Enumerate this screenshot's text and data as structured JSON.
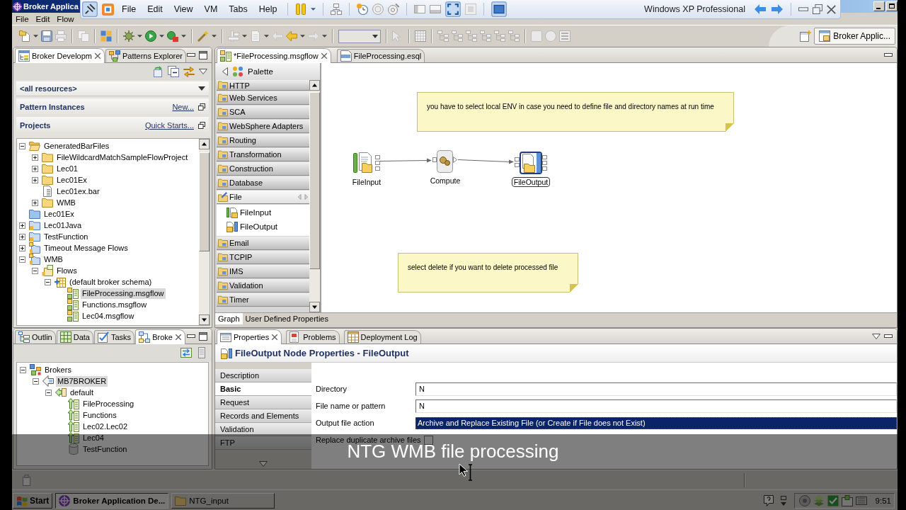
{
  "window": {
    "title": "Broker Applica",
    "menu": [
      "File",
      "Edit",
      "Flow"
    ]
  },
  "vm_toolbar": {
    "menu": [
      "File",
      "Edit",
      "View",
      "VM",
      "Tabs",
      "Help"
    ],
    "guest_name": "Windows XP Professional"
  },
  "perspective": {
    "label": "Broker Applic..."
  },
  "navigator": {
    "tabs": [
      {
        "label": "Broker Developm",
        "selected": true
      },
      {
        "label": "Patterns Explorer",
        "selected": false
      }
    ],
    "filter": "<all resources>",
    "sections": [
      {
        "title": "Pattern Instances",
        "link": "New..."
      },
      {
        "title": "Projects",
        "link": "Quick Starts..."
      }
    ],
    "tree": [
      {
        "label": "GeneratedBarFiles",
        "kind": "folder",
        "expanded": true,
        "selected": false,
        "children": [
          {
            "label": "FileWildcardMatchSampleFlowProject",
            "kind": "folder",
            "expanded": false,
            "selected": false
          },
          {
            "label": "Lec01",
            "kind": "folder",
            "expanded": false,
            "selected": false
          },
          {
            "label": "Lec01Ex",
            "kind": "folder",
            "expanded": false,
            "selected": false
          },
          {
            "label": "Lec01ex.bar",
            "kind": "bar",
            "selected": false
          },
          {
            "label": "WMB",
            "kind": "folder",
            "expanded": false,
            "selected": false
          }
        ]
      },
      {
        "label": "Lec01Ex",
        "kind": "closed-project",
        "selected": false
      },
      {
        "label": "Lec01Java",
        "kind": "project",
        "expanded": false,
        "selected": false
      },
      {
        "label": "TestFunction",
        "kind": "project",
        "expanded": false,
        "selected": false
      },
      {
        "label": "Timeout Message Flows",
        "kind": "flow-project",
        "expanded": false,
        "selected": false
      },
      {
        "label": "WMB",
        "kind": "flow-project",
        "expanded": true,
        "selected": false,
        "children": [
          {
            "label": "Flows",
            "kind": "flows",
            "expanded": true,
            "selected": false,
            "children": [
              {
                "label": "(default broker schema)",
                "kind": "schema",
                "expanded": true,
                "selected": false,
                "children": [
                  {
                    "label": "FileProcessing.msgflow",
                    "kind": "msgflow",
                    "selected": true
                  },
                  {
                    "label": "Functions.msgflow",
                    "kind": "msgflow",
                    "selected": false
                  },
                  {
                    "label": "Lec04.msgflow",
                    "kind": "msgflow",
                    "selected": false
                  }
                ]
              }
            ]
          }
        ]
      }
    ]
  },
  "editor": {
    "tabs": [
      {
        "label": "*FileProcessing.msgflow",
        "kind": "msgflow",
        "selected": true
      },
      {
        "label": "FileProcessing.esql",
        "kind": "esql",
        "selected": false
      }
    ],
    "palette": {
      "title": "Palette",
      "drawers": [
        {
          "label": "HTTP",
          "expanded": false
        },
        {
          "label": "Web Services",
          "expanded": false
        },
        {
          "label": "SCA",
          "expanded": false
        },
        {
          "label": "WebSphere Adapters",
          "expanded": false
        },
        {
          "label": "Routing",
          "expanded": false
        },
        {
          "label": "Transformation",
          "expanded": false
        },
        {
          "label": "Construction",
          "expanded": false
        },
        {
          "label": "Database",
          "expanded": false
        },
        {
          "label": "File",
          "expanded": true,
          "items": [
            "FileInput",
            "FileOutput"
          ]
        },
        {
          "label": "Email",
          "expanded": false
        },
        {
          "label": "TCPIP",
          "expanded": false
        },
        {
          "label": "IMS",
          "expanded": false
        },
        {
          "label": "Validation",
          "expanded": false
        },
        {
          "label": "Timer",
          "expanded": false
        }
      ]
    },
    "notes": [
      {
        "text": "you have to select local ENV in case you need to define file and directory names at run time"
      },
      {
        "text": "select delete if you want to delete processed file"
      }
    ],
    "nodes": [
      {
        "label": "FileInput",
        "kind": "file-input",
        "selected": false,
        "wired_to_next": true
      },
      {
        "label": "Compute",
        "kind": "compute",
        "selected": false,
        "wired_to_next": true
      },
      {
        "label": "FileOutput",
        "kind": "file-output",
        "selected": true,
        "wired_to_next": false
      }
    ],
    "bottom_tabs": [
      {
        "label": "Graph",
        "selected": true
      },
      {
        "label": "User Defined Properties",
        "selected": false
      }
    ]
  },
  "brokers_view": {
    "tabs": [
      {
        "label": "Outlin",
        "selected": false
      },
      {
        "label": "Data",
        "selected": false
      },
      {
        "label": "Tasks",
        "selected": false
      },
      {
        "label": "Broke",
        "selected": true
      }
    ],
    "tree": [
      {
        "label": "Brokers",
        "kind": "brokers",
        "expanded": true,
        "selected": false,
        "children": [
          {
            "label": "MB7BROKER",
            "kind": "broker",
            "expanded": true,
            "selected": true,
            "children": [
              {
                "label": "default",
                "kind": "exec-group",
                "expanded": true,
                "selected": false,
                "children": [
                  {
                    "label": "FileProcessing",
                    "kind": "flow",
                    "selected": false
                  },
                  {
                    "label": "Functions",
                    "kind": "flow",
                    "selected": false
                  },
                  {
                    "label": "Lec02.Lec02",
                    "kind": "flow",
                    "selected": false
                  },
                  {
                    "label": "Lec04",
                    "kind": "flow",
                    "selected": false
                  },
                  {
                    "label": "TestFunction",
                    "kind": "library",
                    "selected": false
                  }
                ]
              }
            ]
          }
        ]
      }
    ]
  },
  "properties_view": {
    "tabs": [
      {
        "label": "Properties",
        "selected": true
      },
      {
        "label": "Problems",
        "selected": false
      },
      {
        "label": "Deployment Log",
        "selected": false
      }
    ],
    "title": "FileOutput Node Properties - FileOutput",
    "sections": [
      {
        "label": "Description",
        "selected": false
      },
      {
        "label": "Basic",
        "selected": true
      },
      {
        "label": "Request",
        "selected": false
      },
      {
        "label": "Records and Elements",
        "selected": false
      },
      {
        "label": "Validation",
        "selected": false
      },
      {
        "label": "FTP",
        "selected": false
      }
    ],
    "fields": [
      {
        "label": "Directory",
        "kind": "text",
        "value": "N"
      },
      {
        "label": "File name or pattern",
        "kind": "text",
        "value": "N"
      },
      {
        "label": "Output file action",
        "kind": "select",
        "value": "Archive and Replace Existing File (or Create if File does not Exist)",
        "focused": true
      },
      {
        "label": "Replace duplicate archive files",
        "kind": "checkbox",
        "checked": false
      }
    ]
  },
  "taskbar": {
    "start": "Start",
    "tasks": [
      {
        "label": "Broker Application De...",
        "kind": "app",
        "selected": true
      },
      {
        "label": "NTG_input",
        "kind": "folder",
        "selected": false
      }
    ],
    "clock": "9:51"
  },
  "caption": "NTG WMB file processing"
}
